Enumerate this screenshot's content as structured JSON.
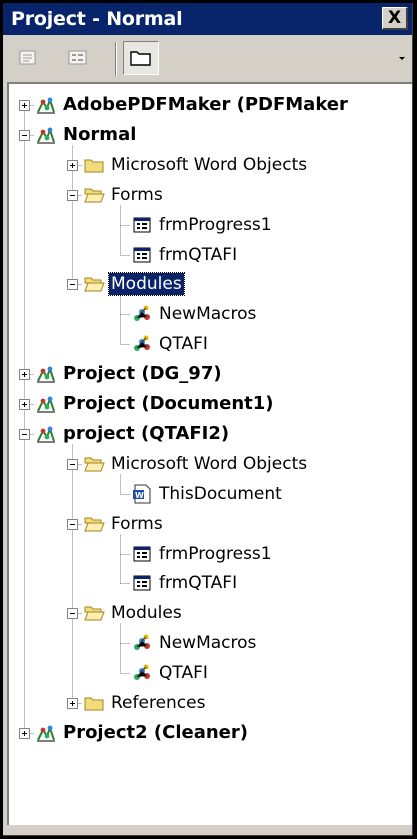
{
  "window": {
    "title": "Project - Normal",
    "close_glyph": "X"
  },
  "toolbar": {
    "buttons": [
      {
        "name": "view-code-icon",
        "pressed": false
      },
      {
        "name": "view-object-icon",
        "pressed": false
      },
      {
        "name": "toggle-folders-icon",
        "pressed": true
      }
    ]
  },
  "tree": [
    {
      "label": "AdobePDFMaker (PDFMaker",
      "depth": 0,
      "kind": "project",
      "expander": "plus",
      "bold": true
    },
    {
      "label": "Normal",
      "depth": 0,
      "kind": "project",
      "expander": "minus",
      "bold": true
    },
    {
      "label": "Microsoft Word Objects",
      "depth": 1,
      "kind": "folder-closed",
      "expander": "plus"
    },
    {
      "label": "Forms",
      "depth": 1,
      "kind": "folder-open",
      "expander": "minus"
    },
    {
      "label": "frmProgress1",
      "depth": 2,
      "kind": "form"
    },
    {
      "label": "frmQTAFI",
      "depth": 2,
      "kind": "form"
    },
    {
      "label": "Modules",
      "depth": 1,
      "kind": "folder-open",
      "expander": "minus",
      "selected": true
    },
    {
      "label": "NewMacros",
      "depth": 2,
      "kind": "module"
    },
    {
      "label": "QTAFI",
      "depth": 2,
      "kind": "module"
    },
    {
      "label": "Project (DG_97)",
      "depth": 0,
      "kind": "project",
      "expander": "plus",
      "bold": true
    },
    {
      "label": "Project (Document1)",
      "depth": 0,
      "kind": "project",
      "expander": "plus",
      "bold": true
    },
    {
      "label": "project (QTAFI2)",
      "depth": 0,
      "kind": "project",
      "expander": "minus",
      "bold": true
    },
    {
      "label": "Microsoft Word Objects",
      "depth": 1,
      "kind": "folder-open",
      "expander": "minus"
    },
    {
      "label": "ThisDocument",
      "depth": 2,
      "kind": "document"
    },
    {
      "label": "Forms",
      "depth": 1,
      "kind": "folder-open",
      "expander": "minus"
    },
    {
      "label": "frmProgress1",
      "depth": 2,
      "kind": "form"
    },
    {
      "label": "frmQTAFI",
      "depth": 2,
      "kind": "form"
    },
    {
      "label": "Modules",
      "depth": 1,
      "kind": "folder-open",
      "expander": "minus"
    },
    {
      "label": "NewMacros",
      "depth": 2,
      "kind": "module"
    },
    {
      "label": "QTAFI",
      "depth": 2,
      "kind": "module"
    },
    {
      "label": "References",
      "depth": 1,
      "kind": "folder-closed",
      "expander": "plus"
    },
    {
      "label": "Project2 (Cleaner)",
      "depth": 0,
      "kind": "project",
      "expander": "plus",
      "bold": true
    }
  ],
  "colors": {
    "titlebar": "#08246b",
    "selection": "#0a246a",
    "face": "#d4d0c8"
  }
}
